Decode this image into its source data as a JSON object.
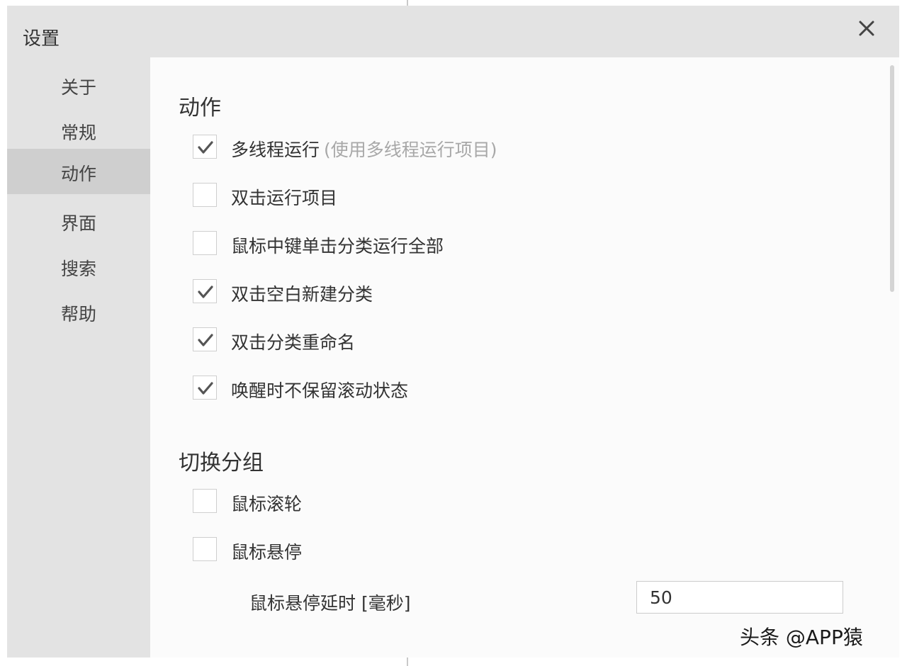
{
  "dialog": {
    "title": "设置",
    "close_icon": "close-icon"
  },
  "sidebar": {
    "items": [
      {
        "label": "关于",
        "active": false
      },
      {
        "label": "常规",
        "active": false
      },
      {
        "label": "动作",
        "active": true
      },
      {
        "label": "界面",
        "active": false
      },
      {
        "label": "搜索",
        "active": false
      },
      {
        "label": "帮助",
        "active": false
      }
    ]
  },
  "main": {
    "section_action": {
      "title": "动作",
      "options": [
        {
          "label": "多线程运行",
          "hint": "(使用多线程运行项目)",
          "checked": true
        },
        {
          "label": "双击运行项目",
          "checked": false
        },
        {
          "label": "鼠标中键单击分类运行全部",
          "checked": false
        },
        {
          "label": "双击空白新建分类",
          "checked": true
        },
        {
          "label": "双击分类重命名",
          "checked": true
        },
        {
          "label": "唤醒时不保留滚动状态",
          "checked": true
        }
      ]
    },
    "section_switch": {
      "title": "切换分组",
      "options": [
        {
          "label": "鼠标滚轮",
          "checked": false
        },
        {
          "label": "鼠标悬停",
          "checked": false
        }
      ],
      "hover_delay": {
        "label": "鼠标悬停延时 [毫秒]",
        "value": "50"
      }
    },
    "cutoff_text": "……"
  },
  "watermark": "头条 @APP猿",
  "colors": {
    "dialog_bg": "#e3e3e3",
    "content_bg": "#fbfbfb",
    "active_item_bg": "#cfcfcf",
    "check_mark": "#555555",
    "hint_text": "#a8a8a8"
  }
}
